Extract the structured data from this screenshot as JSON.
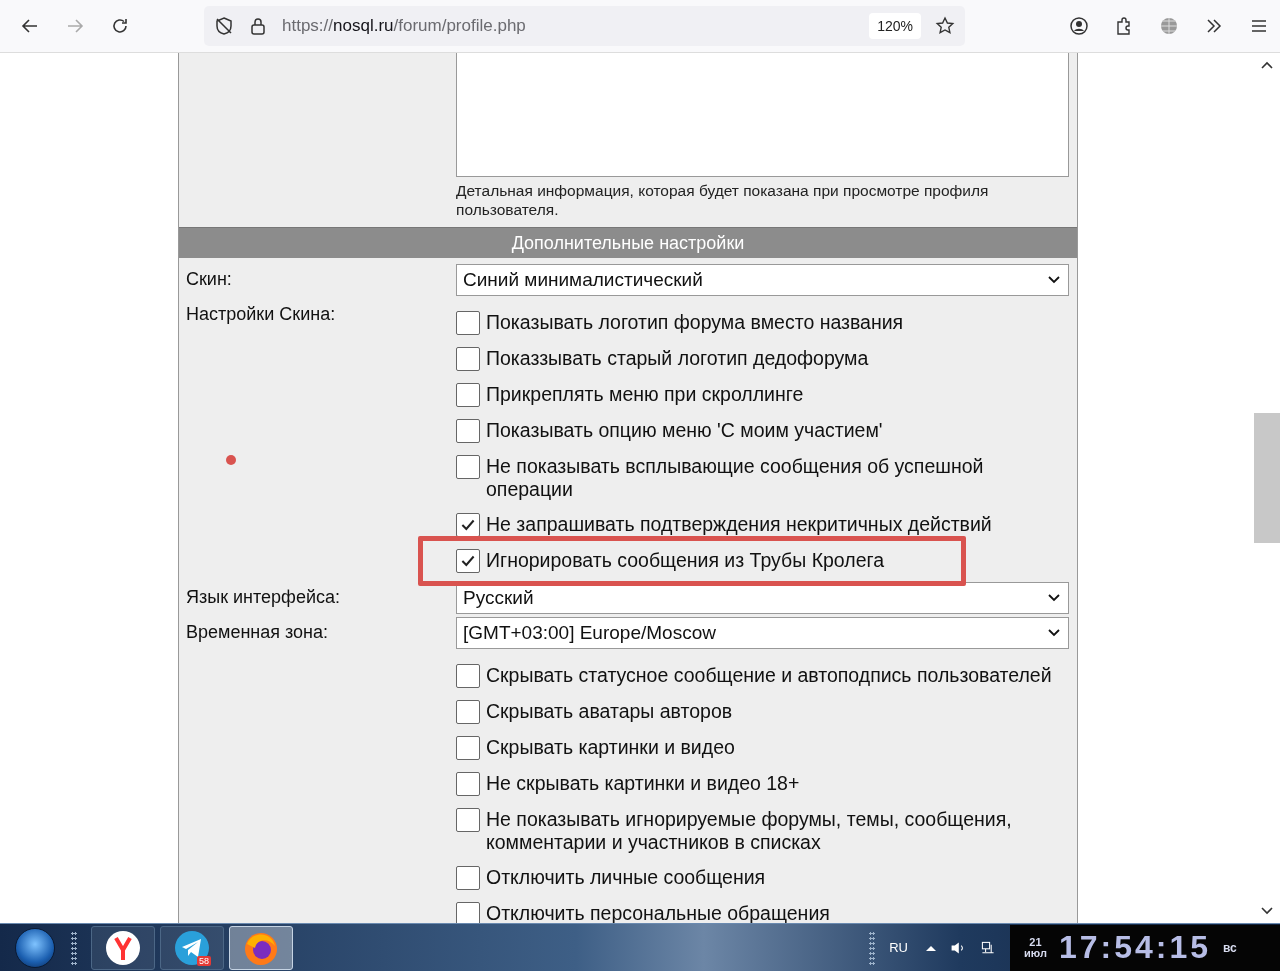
{
  "browser": {
    "url_scheme": "https://",
    "url_host": "nosql.ru",
    "url_path": "/forum/profile.php",
    "zoom": "120%"
  },
  "profile_form": {
    "details_hint": "Детальная информация, которая будет показана при просмотре профиля пользователя.",
    "section_title": "Дополнительные настройки",
    "rows": [
      {
        "kind": "select",
        "label": "Скин:",
        "value": "Синий минималистический"
      },
      {
        "kind": "checkboxes",
        "label": "Настройки Скина:",
        "options": [
          {
            "label": "Показывать логотип форума вместо названия",
            "checked": false,
            "highlighted": false
          },
          {
            "label": "Показзывать старый логотип дедофорума",
            "checked": false,
            "highlighted": false
          },
          {
            "label": "Прикреплять меню при скроллинге",
            "checked": false,
            "highlighted": false
          },
          {
            "label": "Показывать опцию меню 'С моим участием'",
            "checked": false,
            "highlighted": false
          },
          {
            "label": "Не показывать всплывающие сообщения об успешной операции",
            "checked": false,
            "highlighted": false
          },
          {
            "label": "Не запрашивать подтверждения некритичных действий",
            "checked": true,
            "highlighted": false
          },
          {
            "label": "Игнорировать сообщения из Трубы Кролега",
            "checked": true,
            "highlighted": true
          }
        ]
      },
      {
        "kind": "select",
        "label": "Язык интерфейса:",
        "value": "Русский"
      },
      {
        "kind": "select",
        "label": "Временная зона:",
        "value": "[GMT+03:00] Europe/Moscow"
      },
      {
        "kind": "checkboxes",
        "options": [
          {
            "label": "Скрывать статусное сообщение и автоподпись пользователей",
            "checked": false,
            "highlighted": false
          },
          {
            "label": "Скрывать аватары авторов",
            "checked": false,
            "highlighted": false
          },
          {
            "label": "Скрывать картинки и видео",
            "checked": false,
            "highlighted": false
          },
          {
            "label": "Не скрывать картинки и видео 18+",
            "checked": false,
            "highlighted": false
          },
          {
            "label": "Не показывать игнорируемые форумы, темы, сообщения, комментарии и участников в списках",
            "checked": false,
            "highlighted": false
          },
          {
            "label": "Отключить личные сообщения",
            "checked": false,
            "highlighted": false
          },
          {
            "label": "Отключить персональные обращения",
            "checked": false,
            "highlighted": false
          }
        ]
      }
    ]
  },
  "taskbar": {
    "apps": [
      {
        "kind": "yandex",
        "active": false
      },
      {
        "kind": "telegram",
        "active": false,
        "badge": "58"
      },
      {
        "kind": "firefox",
        "active": true
      }
    ],
    "language": "RU",
    "date_day": "21",
    "date_month": "июл",
    "time": "17:54:15",
    "weekday": "вс"
  }
}
